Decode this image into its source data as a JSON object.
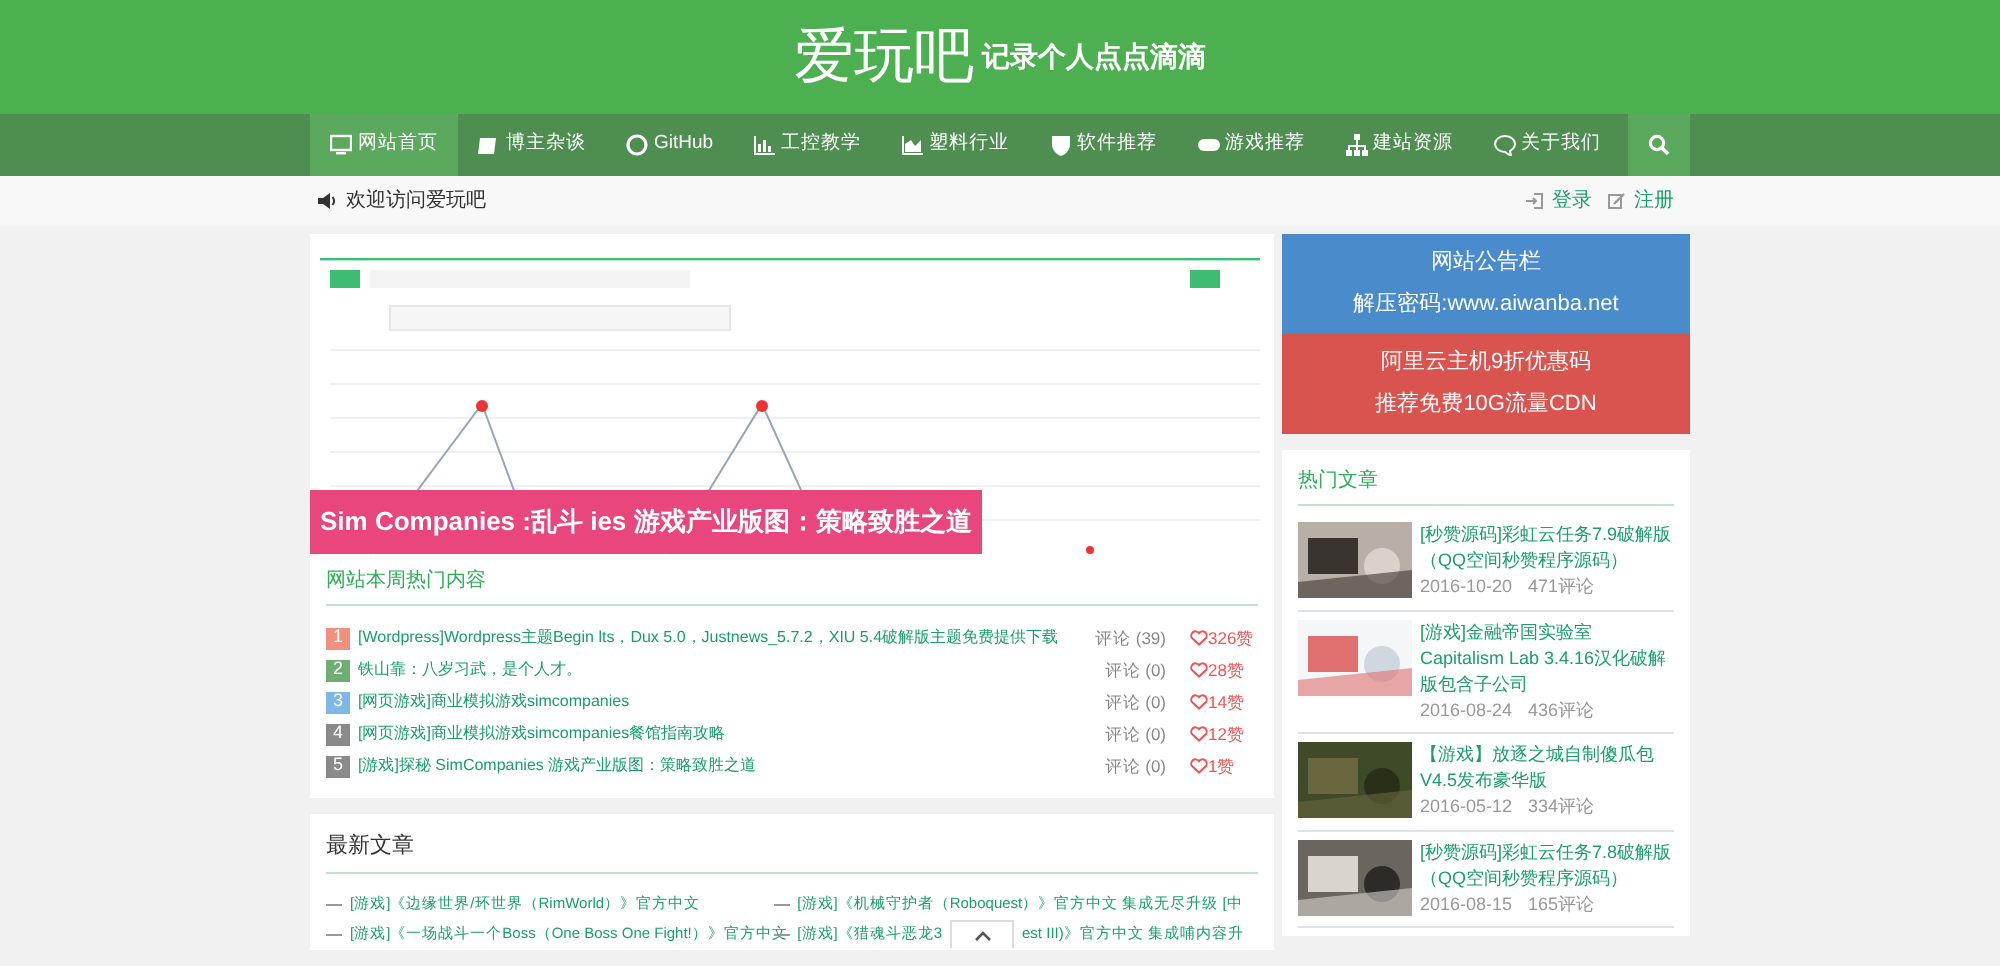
{
  "site": {
    "title": "爱玩吧",
    "tagline": "记录个人点点滴滴"
  },
  "nav": [
    {
      "label": "网站首页",
      "selected": true
    },
    {
      "label": "博主杂谈",
      "selected": false
    },
    {
      "label": "GitHub",
      "selected": false
    },
    {
      "label": "工控教学",
      "selected": false
    },
    {
      "label": "塑料行业",
      "selected": false
    },
    {
      "label": "软件推荐",
      "selected": false
    },
    {
      "label": "游戏推荐",
      "selected": false
    },
    {
      "label": "建站资源",
      "selected": false
    },
    {
      "label": "关于我们",
      "selected": false
    }
  ],
  "welcome": "欢迎访问爱玩吧",
  "auth": [
    {
      "label": "登录"
    },
    {
      "label": "注册"
    }
  ],
  "slider": {
    "caption": "Sim Companies :乱斗 ies 游戏产业版图：策略致胜之道"
  },
  "hot_weekly": {
    "title": "网站本周热门内容",
    "items": [
      {
        "rank": "1",
        "color": "#f0907f",
        "title": "[Wordpress]Wordpress主题Begin lts，Dux 5.0，Justnews_5.7.2，XIU 5.4破解版主题免费提供下载",
        "comments": "评论 (39)",
        "likes": "326赞"
      },
      {
        "rank": "2",
        "color": "#6fae72",
        "title": "铁山靠：八岁习武，是个人才。",
        "comments": "评论 (0)",
        "likes": "28赞"
      },
      {
        "rank": "3",
        "color": "#7fb7e8",
        "title": "[网页游戏]商业模拟游戏simcompanies",
        "comments": "评论 (0)",
        "likes": "14赞"
      },
      {
        "rank": "4",
        "color": "#8a8a8a",
        "title": "[网页游戏]商业模拟游戏simcompanies餐馆指南攻略",
        "comments": "评论 (0)",
        "likes": "12赞"
      },
      {
        "rank": "5",
        "color": "#8a8a8a",
        "title": "[游戏]探秘 SimCompanies 游戏产业版图：策略致胜之道",
        "comments": "评论 (0)",
        "likes": "1赞"
      }
    ]
  },
  "notices": [
    {
      "color": "#4a8bcb",
      "lines": [
        "网站公告栏",
        "解压密码:www.aiwanba.net"
      ]
    },
    {
      "color": "#d9534f",
      "lines": [
        "阿里云主机9折优惠码",
        "推荐免费10G流量CDN"
      ]
    }
  ],
  "hot_articles": {
    "title": "热门文章",
    "items": [
      {
        "title": "[秒赞源码]彩虹云任务7.9破解版（QQ空间秒赞程序源码）",
        "date": "2016-10-20",
        "comments": "471评论"
      },
      {
        "title": "[游戏]金融帝国实验室Capitalism Lab 3.4.16汉化破解版包含子公司",
        "date": "2016-08-24",
        "comments": "436评论"
      },
      {
        "title": "【游戏】放逐之城自制傻瓜包V4.5发布豪华版",
        "date": "2016-05-12",
        "comments": "334评论"
      },
      {
        "title": "[秒赞源码]彩虹云任务7.8破解版（QQ空间秒赞程序源码）",
        "date": "2016-08-15",
        "comments": "165评论"
      }
    ]
  },
  "latest": {
    "title": "最新文章",
    "rows": [
      [
        {
          "parts": [
            "[游戏]《边缘世界/环世界（RimWorld）》官方中文"
          ]
        },
        {
          "parts": [
            "[游戏]《机械守护者（Roboquest）》官方中文 集成无尽升级 [中"
          ]
        }
      ],
      [
        {
          "parts": [
            "[游戏]《一场战斗一个Boss（One Boss One Fight!）》官方中文"
          ]
        },
        {
          "parts": [
            "[游戏]《猎魂斗恶龙3",
            "est III)》官方中文 集成哺内容升"
          ]
        }
      ]
    ]
  }
}
